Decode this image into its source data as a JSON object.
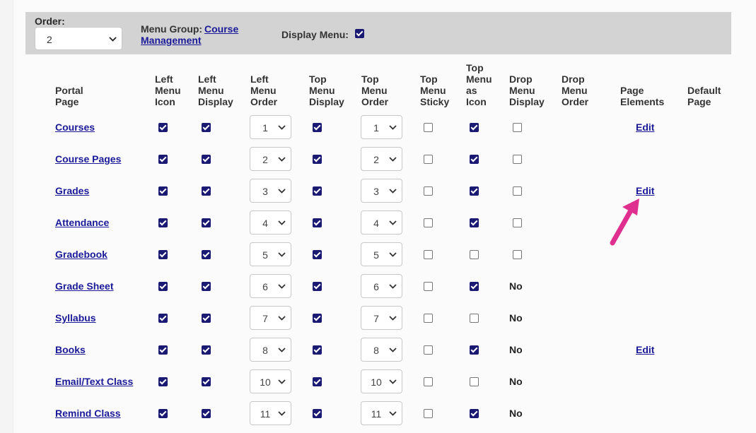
{
  "header": {
    "order_label": "Order:",
    "order_value": "2",
    "menu_group_label": "Menu Group:",
    "menu_group_link_line1": "Course",
    "menu_group_link_line2": "Management",
    "display_menu_label": "Display Menu:",
    "display_menu_checked": true
  },
  "columns": {
    "portal_page": [
      "Portal",
      "Page"
    ],
    "left_menu_icon": [
      "Left",
      "Menu",
      "Icon"
    ],
    "left_menu_display": [
      "Left",
      "Menu",
      "Display"
    ],
    "left_menu_order": [
      "Left",
      "Menu",
      "Order"
    ],
    "top_menu_display": [
      "Top",
      "Menu",
      "Display"
    ],
    "top_menu_order": [
      "Top",
      "Menu",
      "Order"
    ],
    "top_menu_sticky": [
      "Top",
      "Menu",
      "Sticky"
    ],
    "top_menu_as_icon": [
      "Top",
      "Menu",
      "as",
      "Icon"
    ],
    "drop_menu_display": [
      "Drop",
      "Menu",
      "Display"
    ],
    "drop_menu_order": [
      "Drop",
      "Menu",
      "Order"
    ],
    "page_elements": [
      "Page",
      "Elements"
    ],
    "default_page": [
      "Default",
      "Page"
    ]
  },
  "rows": [
    {
      "page": "Courses",
      "left_icon": true,
      "left_display": true,
      "left_order": "1",
      "top_display": true,
      "top_order": "1",
      "sticky": false,
      "top_as_icon": true,
      "drop_display": "unchecked",
      "page_elements": "Edit"
    },
    {
      "page": "Course Pages",
      "left_icon": true,
      "left_display": true,
      "left_order": "2",
      "top_display": true,
      "top_order": "2",
      "sticky": false,
      "top_as_icon": true,
      "drop_display": "unchecked",
      "page_elements": ""
    },
    {
      "page": "Grades",
      "left_icon": true,
      "left_display": true,
      "left_order": "3",
      "top_display": true,
      "top_order": "3",
      "sticky": false,
      "top_as_icon": true,
      "drop_display": "unchecked",
      "page_elements": "Edit"
    },
    {
      "page": "Attendance",
      "left_icon": true,
      "left_display": true,
      "left_order": "4",
      "top_display": true,
      "top_order": "4",
      "sticky": false,
      "top_as_icon": true,
      "drop_display": "unchecked",
      "page_elements": ""
    },
    {
      "page": "Gradebook",
      "left_icon": true,
      "left_display": true,
      "left_order": "5",
      "top_display": true,
      "top_order": "5",
      "sticky": false,
      "top_as_icon": false,
      "drop_display": "unchecked",
      "page_elements": ""
    },
    {
      "page": "Grade Sheet",
      "left_icon": true,
      "left_display": true,
      "left_order": "6",
      "top_display": true,
      "top_order": "6",
      "sticky": false,
      "top_as_icon": true,
      "drop_display": "No",
      "page_elements": ""
    },
    {
      "page": "Syllabus",
      "left_icon": true,
      "left_display": true,
      "left_order": "7",
      "top_display": true,
      "top_order": "7",
      "sticky": false,
      "top_as_icon": false,
      "drop_display": "No",
      "page_elements": ""
    },
    {
      "page": "Books",
      "left_icon": true,
      "left_display": true,
      "left_order": "8",
      "top_display": true,
      "top_order": "8",
      "sticky": false,
      "top_as_icon": true,
      "drop_display": "No",
      "page_elements": "Edit"
    },
    {
      "page": "Email/Text Class",
      "left_icon": true,
      "left_display": true,
      "left_order": "10",
      "top_display": true,
      "top_order": "10",
      "sticky": false,
      "top_as_icon": false,
      "drop_display": "No",
      "page_elements": ""
    },
    {
      "page": "Remind Class",
      "left_icon": true,
      "left_display": true,
      "left_order": "11",
      "top_display": true,
      "top_order": "11",
      "sticky": false,
      "top_as_icon": true,
      "drop_display": "No",
      "page_elements": ""
    }
  ],
  "colors": {
    "link": "#1a1a99",
    "checkbox_fill": "#1a1a73",
    "header_bar": "#d3d3d3",
    "annotation_arrow": "#e0308f"
  },
  "annotation": {
    "icon": "arrow-icon",
    "points_to": "Grades page elements Edit"
  }
}
